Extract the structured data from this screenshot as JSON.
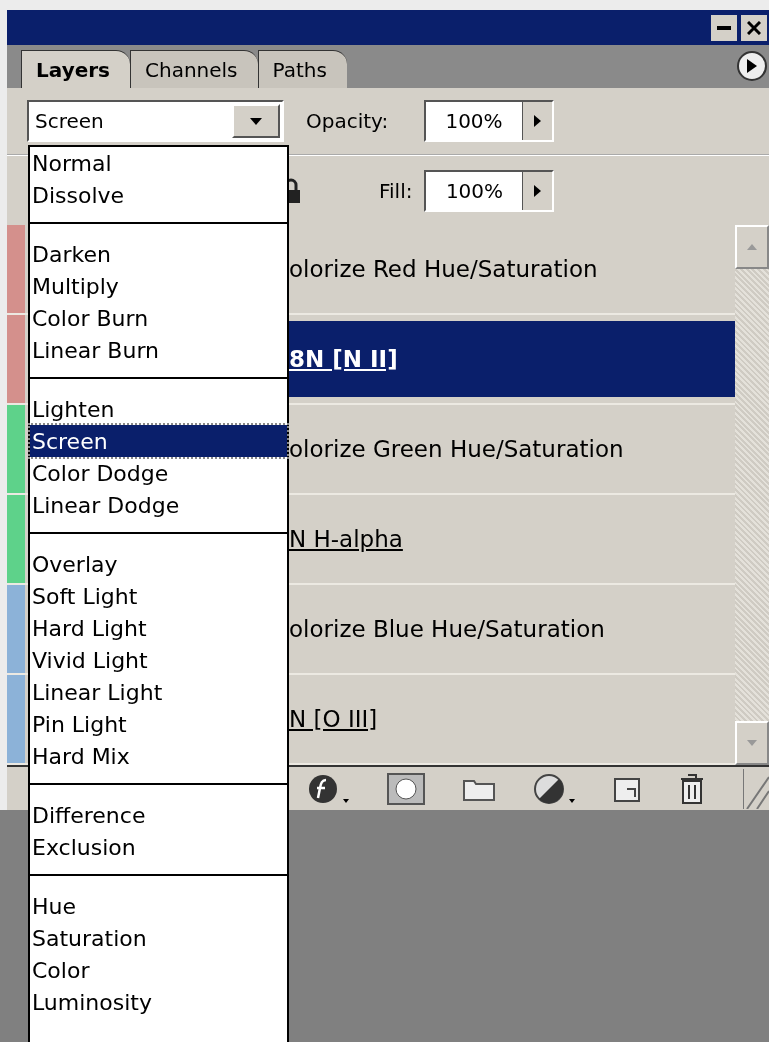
{
  "tabs": [
    {
      "label": "Layers",
      "selected": true
    },
    {
      "label": "Channels",
      "selected": false
    },
    {
      "label": "Paths",
      "selected": false
    }
  ],
  "blend_mode": {
    "value": "Screen",
    "expanded": true
  },
  "opacity": {
    "label": "Opacity:",
    "value": "100%"
  },
  "fill": {
    "label": "Fill:",
    "value": "100%"
  },
  "blend_menu": {
    "groups": [
      {
        "items": [
          {
            "label": "Normal",
            "selected": false
          },
          {
            "label": "Dissolve",
            "selected": false
          }
        ]
      },
      {
        "items": [
          {
            "label": "Darken",
            "selected": false
          },
          {
            "label": "Multiply",
            "selected": false
          },
          {
            "label": "Color Burn",
            "selected": false
          },
          {
            "label": "Linear Burn",
            "selected": false
          }
        ]
      },
      {
        "items": [
          {
            "label": "Lighten",
            "selected": false
          },
          {
            "label": "Screen",
            "selected": true
          },
          {
            "label": "Color Dodge",
            "selected": false
          },
          {
            "label": "Linear Dodge",
            "selected": false
          }
        ]
      },
      {
        "items": [
          {
            "label": "Overlay",
            "selected": false
          },
          {
            "label": "Soft Light",
            "selected": false
          },
          {
            "label": "Hard Light",
            "selected": false
          },
          {
            "label": "Vivid Light",
            "selected": false
          },
          {
            "label": "Linear Light",
            "selected": false
          },
          {
            "label": "Pin Light",
            "selected": false
          },
          {
            "label": "Hard Mix",
            "selected": false
          }
        ]
      },
      {
        "items": [
          {
            "label": "Difference",
            "selected": false
          },
          {
            "label": "Exclusion",
            "selected": false
          }
        ]
      },
      {
        "items": [
          {
            "label": "Hue",
            "selected": false
          },
          {
            "label": "Saturation",
            "selected": false
          },
          {
            "label": "Color",
            "selected": false
          },
          {
            "label": "Luminosity",
            "selected": false
          }
        ]
      }
    ]
  },
  "layers": [
    {
      "name": "olorize Red Hue/Saturation",
      "kind": "adjustment",
      "selected": false,
      "color": "#d4908c"
    },
    {
      "name": "8N [N II]",
      "kind": "image",
      "selected": true,
      "color": "#d4908c"
    },
    {
      "name": "olorize Green Hue/Saturation",
      "kind": "adjustment",
      "selected": false,
      "color": "#5ed28a"
    },
    {
      "name": "N H-alpha",
      "kind": "image",
      "selected": false,
      "color": "#5ed28a"
    },
    {
      "name": "olorize Blue Hue/Saturation",
      "kind": "adjustment",
      "selected": false,
      "color": "#8cb2d8"
    },
    {
      "name": "N [O III]",
      "kind": "image",
      "selected": false,
      "color": "#8cb2d8"
    }
  ]
}
